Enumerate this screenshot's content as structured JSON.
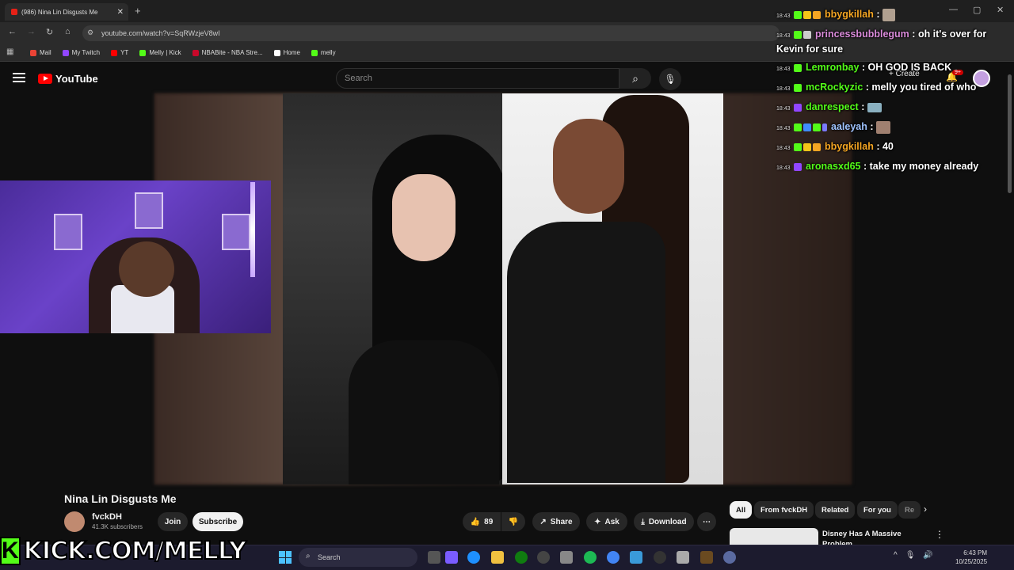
{
  "browser": {
    "tab_title": "(986) Nina Lin Disgusts Me",
    "url": "youtube.com/watch?v=SqRWzjeV8wI",
    "bookmarks": [
      {
        "label": "Mail",
        "color": "#ea4335"
      },
      {
        "label": "My Twitch",
        "color": "#9146ff"
      },
      {
        "label": "YT",
        "color": "#ff0000"
      },
      {
        "label": "Melly | Kick",
        "color": "#53fc18"
      },
      {
        "label": "NBABite - NBA Stre...",
        "color": "#c9082a"
      },
      {
        "label": "Home",
        "color": "#ffffff"
      },
      {
        "label": "melly",
        "color": "#53fc18"
      }
    ]
  },
  "youtube": {
    "logo": "YouTube",
    "search_placeholder": "Search",
    "create_label": "Create",
    "notif_count": "9+"
  },
  "chat": [
    {
      "time": "18:43",
      "user": "bbygkillah",
      "color": "#f5a623",
      "text": "",
      "badges": [
        "#53fc18",
        "#f5c518",
        "#f5a623"
      ]
    },
    {
      "time": "18:43",
      "user": "princessbubblegum",
      "color": "#d98ad9",
      "text": "oh it's over for Kevin for sure",
      "badges": [
        "#53fc18"
      ]
    },
    {
      "time": "18:43",
      "user": "Lemronbay",
      "color": "#53fc18",
      "text": "OH GOD IS BACK",
      "badges": [
        "#53fc18"
      ]
    },
    {
      "time": "18:43",
      "user": "mcRockyzic",
      "color": "#53fc18",
      "text": "melly you tired of who",
      "badges": [
        "#53fc18"
      ]
    },
    {
      "time": "18:43",
      "user": "danrespect",
      "color": "#53fc18",
      "text": "",
      "badges": [
        "#9146ff"
      ]
    },
    {
      "time": "18:43",
      "user": "aaleyah",
      "color": "#9fc3ff",
      "text": "",
      "badges": [
        "#53fc18",
        "#3f8cff",
        "#53fc18",
        "#7a7aff"
      ]
    },
    {
      "time": "18:43",
      "user": "bbygkillah",
      "color": "#f5a623",
      "text": "40",
      "badges": [
        "#53fc18",
        "#f5c518",
        "#f5a623"
      ]
    },
    {
      "time": "18:43",
      "user": "aronasxd65",
      "color": "#53fc18",
      "text": "take my money already",
      "badges": [
        "#9146ff"
      ]
    }
  ],
  "video": {
    "title": "Nina Lin Disgusts Me",
    "channel": "fvckDH",
    "subscribers": "41.3K subscribers",
    "join_label": "Join",
    "subscribe_label": "Subscribe",
    "likes": "89",
    "share_label": "Share",
    "ask_label": "Ask",
    "download_label": "Download"
  },
  "chips": [
    "All",
    "From fvckDH",
    "Related",
    "For you",
    "Re"
  ],
  "recommended": {
    "title": "Disney Has A Massive Problem"
  },
  "overlay": {
    "kick_text": "KICK.COM/MELLY",
    "kick_k": "K"
  },
  "taskbar": {
    "search_label": "Search",
    "time": "6:43 PM",
    "date": "10/25/2025"
  }
}
